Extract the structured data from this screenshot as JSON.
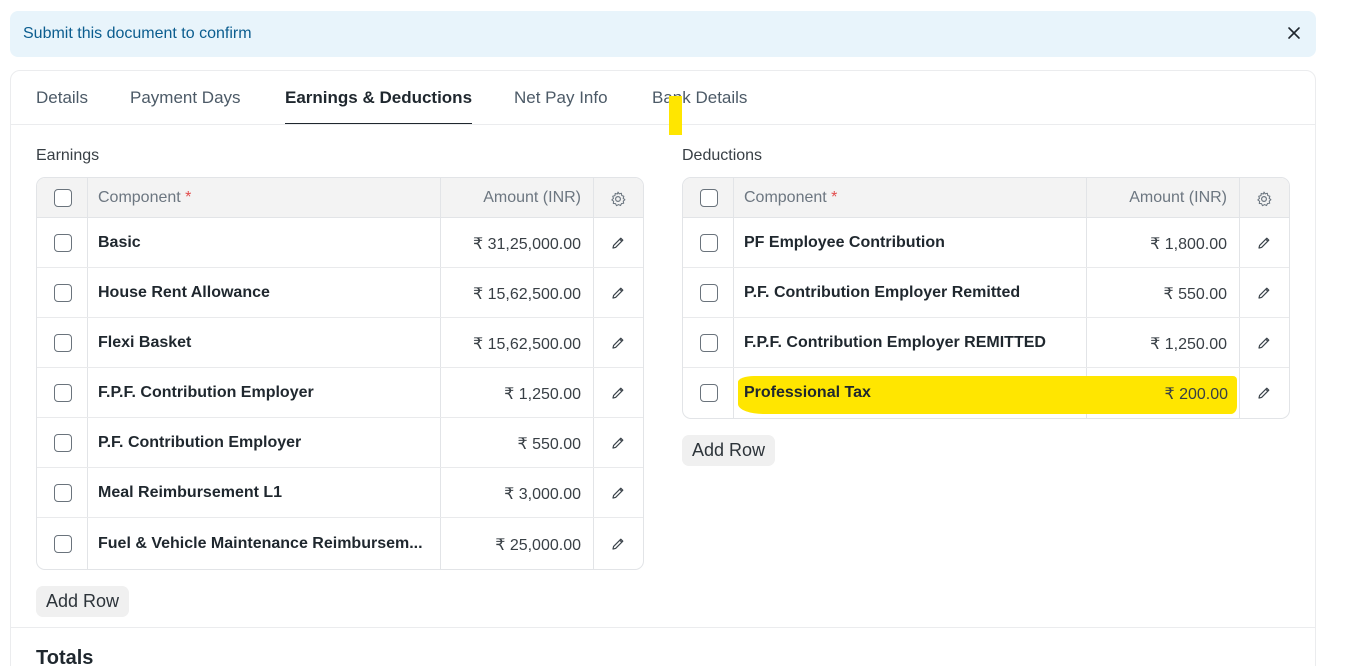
{
  "alert": {
    "message": "Submit this document to confirm",
    "close_icon": "close-icon"
  },
  "tabs": [
    {
      "label": "Details"
    },
    {
      "label": "Payment Days"
    },
    {
      "label": "Earnings & Deductions",
      "active": true
    },
    {
      "label": "Net Pay Info"
    },
    {
      "label": "Bank Details"
    }
  ],
  "earnings": {
    "label": "Earnings",
    "columns": {
      "component": "Component",
      "required_mark": "*",
      "amount": "Amount (INR)"
    },
    "rows": [
      {
        "component": "Basic",
        "amount": "₹ 31,25,000.00"
      },
      {
        "component": "House Rent Allowance",
        "amount": "₹ 15,62,500.00"
      },
      {
        "component": "Flexi Basket",
        "amount": "₹ 15,62,500.00"
      },
      {
        "component": "F.P.F. Contribution Employer",
        "amount": "₹ 1,250.00"
      },
      {
        "component": "P.F. Contribution Employer",
        "amount": "₹ 550.00"
      },
      {
        "component": "Meal Reimbursement L1",
        "amount": "₹ 3,000.00"
      },
      {
        "component": "Fuel & Vehicle Maintenance Reimbursem...",
        "amount": "₹ 25,000.00"
      }
    ],
    "add_row_label": "Add Row"
  },
  "deductions": {
    "label": "Deductions",
    "columns": {
      "component": "Component",
      "required_mark": "*",
      "amount": "Amount (INR)"
    },
    "rows": [
      {
        "component": "PF Employee Contribution",
        "amount": "₹ 1,800.00"
      },
      {
        "component": "P.F. Contribution Employer Remitted",
        "amount": "₹ 550.00"
      },
      {
        "component": "F.P.F. Contribution Employer REMITTED",
        "amount": "₹ 1,250.00"
      },
      {
        "component": "Professional Tax",
        "amount": "₹ 200.00"
      }
    ],
    "add_row_label": "Add Row"
  },
  "totals": {
    "label": "Totals"
  },
  "colors": {
    "highlight": "#ffe600",
    "alert_bg": "#e8f4fb",
    "alert_text": "#0b5d8f",
    "required": "#e24c4c"
  }
}
